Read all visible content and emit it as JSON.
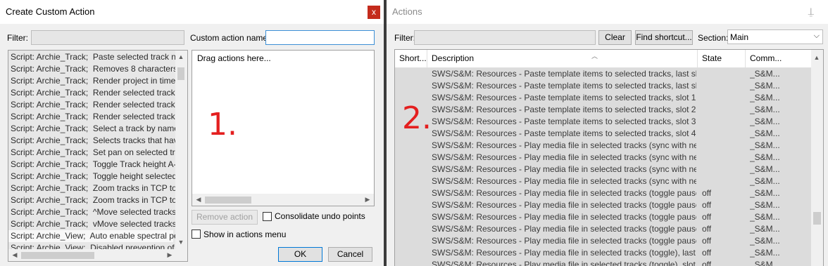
{
  "left_window": {
    "title": "Create Custom Action",
    "close_glyph": "x",
    "filter_label": "Filter:",
    "filter_value": "",
    "name_label": "Custom action name:",
    "name_value": "",
    "action_list": [
      "Script: Archie_Track;  Paste selected track name",
      "Script: Archie_Track;  Removes 8 characters fror",
      "Script: Archie_Track;  Render project in time sele",
      "Script: Archie_Track;  Render selected tracks on",
      "Script: Archie_Track;  Render selected tracks on",
      "Script: Archie_Track;  Render selected tracks on",
      "Script: Archie_Track;  Select a track by name(abl",
      "Script: Archie_Track;  Selects tracks that have _",
      "Script: Archie_Track;  Set pan on selected tracks",
      "Script: Archie_Track;  Toggle Track height A-B C",
      "Script: Archie_Track;  Toggle height selected trac",
      "Script: Archie_Track;  Zoom tracks in TCP to fit s",
      "Script: Archie_Track;  Zoom tracks in TCP to fit s",
      "Script: Archie_Track;  ^Move selected tracks in u",
      "Script: Archie_Track;  vMove selected tracks in c",
      "Script: Archie_View;  Auto enable spectral peaks",
      "Script: Archie_View;  Disabled prevention of spec"
    ],
    "selected_index": 15,
    "drop_placeholder": "Drag actions here...",
    "annotation_1": "1.",
    "remove_action_label": "Remove action",
    "consolidate_label": "Consolidate undo points",
    "consolidate_checked": false,
    "show_in_menu_label": "Show in actions menu",
    "show_in_menu_checked": false,
    "ok_label": "OK",
    "cancel_label": "Cancel"
  },
  "right_window": {
    "title": "Actions",
    "pin_icon": "pin-icon",
    "filter_label": "Filter:",
    "filter_value": "",
    "clear_label": "Clear",
    "find_shortcut_label": "Find shortcut...",
    "section_label": "Section:",
    "section_value": "Main",
    "annotation_2": "2.",
    "columns": [
      "Short...",
      "Description",
      "State",
      "Comm..."
    ],
    "rows": [
      {
        "shortcut": "",
        "description": "SWS/S&M: Resources - Paste template items to selected tracks, last slot",
        "state": "",
        "command": "_S&M..."
      },
      {
        "shortcut": "",
        "description": "SWS/S&M: Resources - Paste template items to selected tracks, last slot",
        "state": "",
        "command": "_S&M..."
      },
      {
        "shortcut": "",
        "description": "SWS/S&M: Resources - Paste template items to selected tracks, slot 1",
        "state": "",
        "command": "_S&M..."
      },
      {
        "shortcut": "",
        "description": "SWS/S&M: Resources - Paste template items to selected tracks, slot 2",
        "state": "",
        "command": "_S&M..."
      },
      {
        "shortcut": "",
        "description": "SWS/S&M: Resources - Paste template items to selected tracks, slot 3",
        "state": "",
        "command": "_S&M..."
      },
      {
        "shortcut": "",
        "description": "SWS/S&M: Resources - Paste template items to selected tracks, slot 4",
        "state": "",
        "command": "_S&M..."
      },
      {
        "shortcut": "",
        "description": "SWS/S&M: Resources - Play media file in selected tracks (sync with next me...",
        "state": "",
        "command": "_S&M..."
      },
      {
        "shortcut": "",
        "description": "SWS/S&M: Resources - Play media file in selected tracks (sync with next me...",
        "state": "",
        "command": "_S&M..."
      },
      {
        "shortcut": "",
        "description": "SWS/S&M: Resources - Play media file in selected tracks (sync with next me...",
        "state": "",
        "command": "_S&M..."
      },
      {
        "shortcut": "",
        "description": "SWS/S&M: Resources - Play media file in selected tracks (sync with next me...",
        "state": "",
        "command": "_S&M..."
      },
      {
        "shortcut": "",
        "description": "SWS/S&M: Resources - Play media file in selected tracks (toggle pause), las...",
        "state": "off",
        "command": "_S&M..."
      },
      {
        "shortcut": "",
        "description": "SWS/S&M: Resources - Play media file in selected tracks (toggle pause), slo...",
        "state": "off",
        "command": "_S&M..."
      },
      {
        "shortcut": "",
        "description": "SWS/S&M: Resources - Play media file in selected tracks (toggle pause), slo...",
        "state": "off",
        "command": "_S&M..."
      },
      {
        "shortcut": "",
        "description": "SWS/S&M: Resources - Play media file in selected tracks (toggle pause), slo...",
        "state": "off",
        "command": "_S&M..."
      },
      {
        "shortcut": "",
        "description": "SWS/S&M: Resources - Play media file in selected tracks (toggle pause), slo...",
        "state": "off",
        "command": "_S&M..."
      },
      {
        "shortcut": "",
        "description": "SWS/S&M: Resources - Play media file in selected tracks (toggle), last slot",
        "state": "off",
        "command": "_S&M..."
      },
      {
        "shortcut": "",
        "description": "SWS/S&M: Resources - Play media file in selected tracks (toggle), slot 1",
        "state": "off",
        "command": "_S&M..."
      }
    ]
  },
  "colors": {
    "annotation_red": "#e41f1f",
    "close_red": "#c42b1c",
    "focus_blue": "#3c8fd6"
  }
}
